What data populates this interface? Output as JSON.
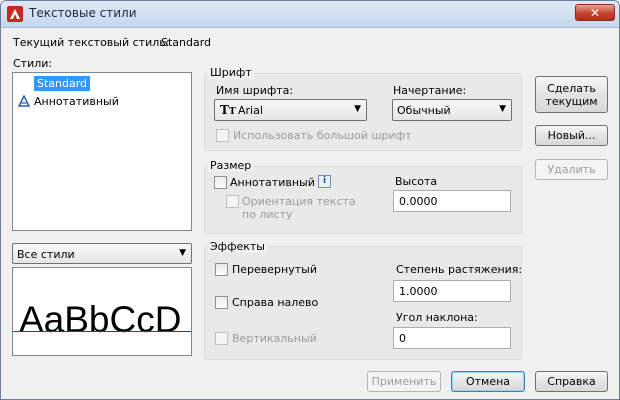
{
  "window": {
    "title": "Текстовые стили",
    "close_label": "✕"
  },
  "current_style": {
    "label": "Текущий текстовый стиль:",
    "value": "Standard"
  },
  "styles": {
    "label": "Стили:",
    "items": [
      {
        "label": "Standard"
      },
      {
        "label": "Аннотативный"
      }
    ],
    "filter_value": "Все стили",
    "preview_text": "AaBbCcD"
  },
  "font": {
    "group_title": "Шрифт",
    "name_label": "Имя шрифта:",
    "name_value": "Arial",
    "style_label": "Начертание:",
    "style_value": "Обычный",
    "bigfont_label": "Использовать большой шрифт"
  },
  "size": {
    "group_title": "Размер",
    "annotative_label": "Аннотативный",
    "orientation_label_line1": "Ориентация текста",
    "orientation_label_line2": "по листу",
    "height_label": "Высота",
    "height_value": "0.0000"
  },
  "effects": {
    "group_title": "Эффекты",
    "upside_down_label": "Перевернутый",
    "backwards_label": "Справа налево",
    "vertical_label": "Вертикальный",
    "width_factor_label": "Степень растяжения:",
    "width_factor_value": "1.0000",
    "oblique_label": "Угол наклона:",
    "oblique_value": "0"
  },
  "buttons": {
    "set_current_line1": "Сделать",
    "set_current_line2": "текущим",
    "new": "Новый...",
    "delete": "Удалить",
    "apply": "Применить",
    "cancel": "Отмена",
    "help": "Справка"
  },
  "colors": {
    "selection": "#3399ff",
    "close_button": "#c4452f",
    "baseline": "#cc0000"
  }
}
